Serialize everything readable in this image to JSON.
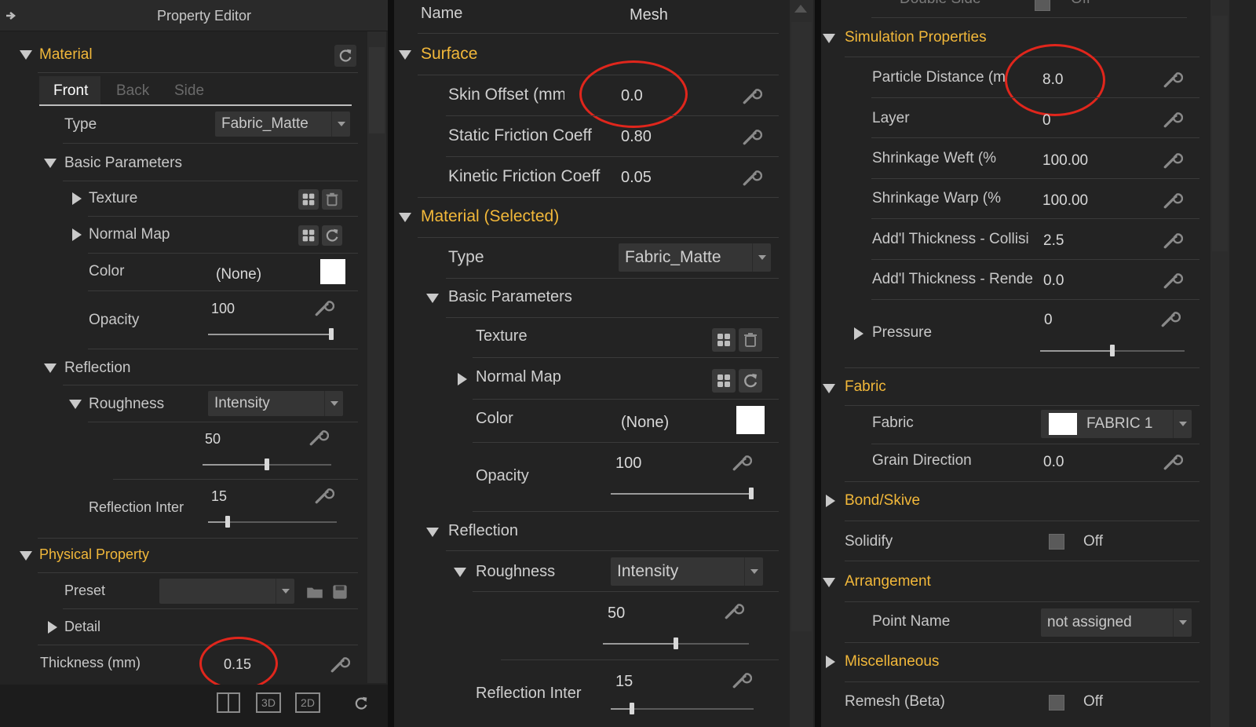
{
  "left": {
    "title": "Property Editor",
    "material_label": "Material",
    "tabs": [
      "Front",
      "Back",
      "Side"
    ],
    "type_label": "Type",
    "type_value": "Fabric_Matte",
    "basic_params": "Basic Parameters",
    "texture": "Texture",
    "normal_map": "Normal Map",
    "color_label": "Color",
    "color_value": "(None)",
    "opacity_label": "Opacity",
    "opacity_value": "100",
    "reflection": "Reflection",
    "roughness": "Roughness",
    "roughness_mode": "Intensity",
    "roughness_value": "50",
    "refl_inter_label": "Reflection Inter",
    "refl_inter_value": "15",
    "physical": "Physical Property",
    "preset_label": "Preset",
    "detail": "Detail",
    "thickness_label": "Thickness (mm)",
    "thickness_value": "0.15",
    "bottom_3d": "3D",
    "bottom_2d": "2D"
  },
  "mid": {
    "name_label": "Name",
    "name_value": "Mesh",
    "surface": "Surface",
    "skin_offset_label": "Skin Offset (mm)",
    "skin_offset_value": "0.0",
    "static_label": "Static Friction Coeffi",
    "static_value": "0.80",
    "kinetic_label": "Kinetic Friction Coeff",
    "kinetic_value": "0.05",
    "material_selected": "Material (Selected)",
    "type_label": "Type",
    "type_value": "Fabric_Matte",
    "basic_params": "Basic Parameters",
    "texture": "Texture",
    "normal_map": "Normal Map",
    "color_label": "Color",
    "color_value": "(None)",
    "opacity_label": "Opacity",
    "opacity_value": "100",
    "reflection": "Reflection",
    "roughness": "Roughness",
    "roughness_mode": "Intensity",
    "roughness_value": "50",
    "refl_inter_label": "Reflection Inter",
    "refl_inter_value": "15"
  },
  "right": {
    "double_side_label": "Double Side",
    "double_side_value": "Off",
    "sim_props": "Simulation Properties",
    "particle_label": "Particle Distance (m",
    "particle_value": "8.0",
    "layer_label": "Layer",
    "layer_value": "0",
    "weft_label": "Shrinkage Weft (%",
    "weft_value": "100.00",
    "warp_label": "Shrinkage Warp (%",
    "warp_value": "100.00",
    "add_coll_label": "Add'l Thickness - Collisi",
    "add_coll_value": "2.5",
    "add_rend_label": "Add'l Thickness - Rende",
    "add_rend_value": "0.0",
    "pressure_label": "Pressure",
    "pressure_value": "0",
    "fabric_section": "Fabric",
    "fabric_label": "Fabric",
    "fabric_value": "FABRIC 1",
    "grain_label": "Grain Direction",
    "grain_value": "0.0",
    "bond": "Bond/Skive",
    "solidify_label": "Solidify",
    "solidify_value": "Off",
    "arrangement": "Arrangement",
    "point_name_label": "Point Name",
    "point_name_value": "not assigned",
    "misc": "Miscellaneous",
    "remesh_label": "Remesh (Beta)",
    "remesh_value": "Off"
  },
  "sliders": {
    "left_opacity": 1.0,
    "left_roughness": 0.5,
    "left_refl_inter": 0.15,
    "mid_opacity": 1.0,
    "mid_roughness": 0.5,
    "mid_refl_inter": 0.15,
    "right_pressure": 0.5
  },
  "icons": {
    "wrench": "wrench-icon",
    "refresh": "refresh-icon",
    "grid": "grid-icon",
    "trash": "trash-icon",
    "folder": "folder-icon",
    "save": "save-icon",
    "arrow": "arrow-icon"
  },
  "colors": {
    "accent": "#f2b83a",
    "highlight_circle": "#e0261c",
    "panel_bg": "#232323"
  }
}
